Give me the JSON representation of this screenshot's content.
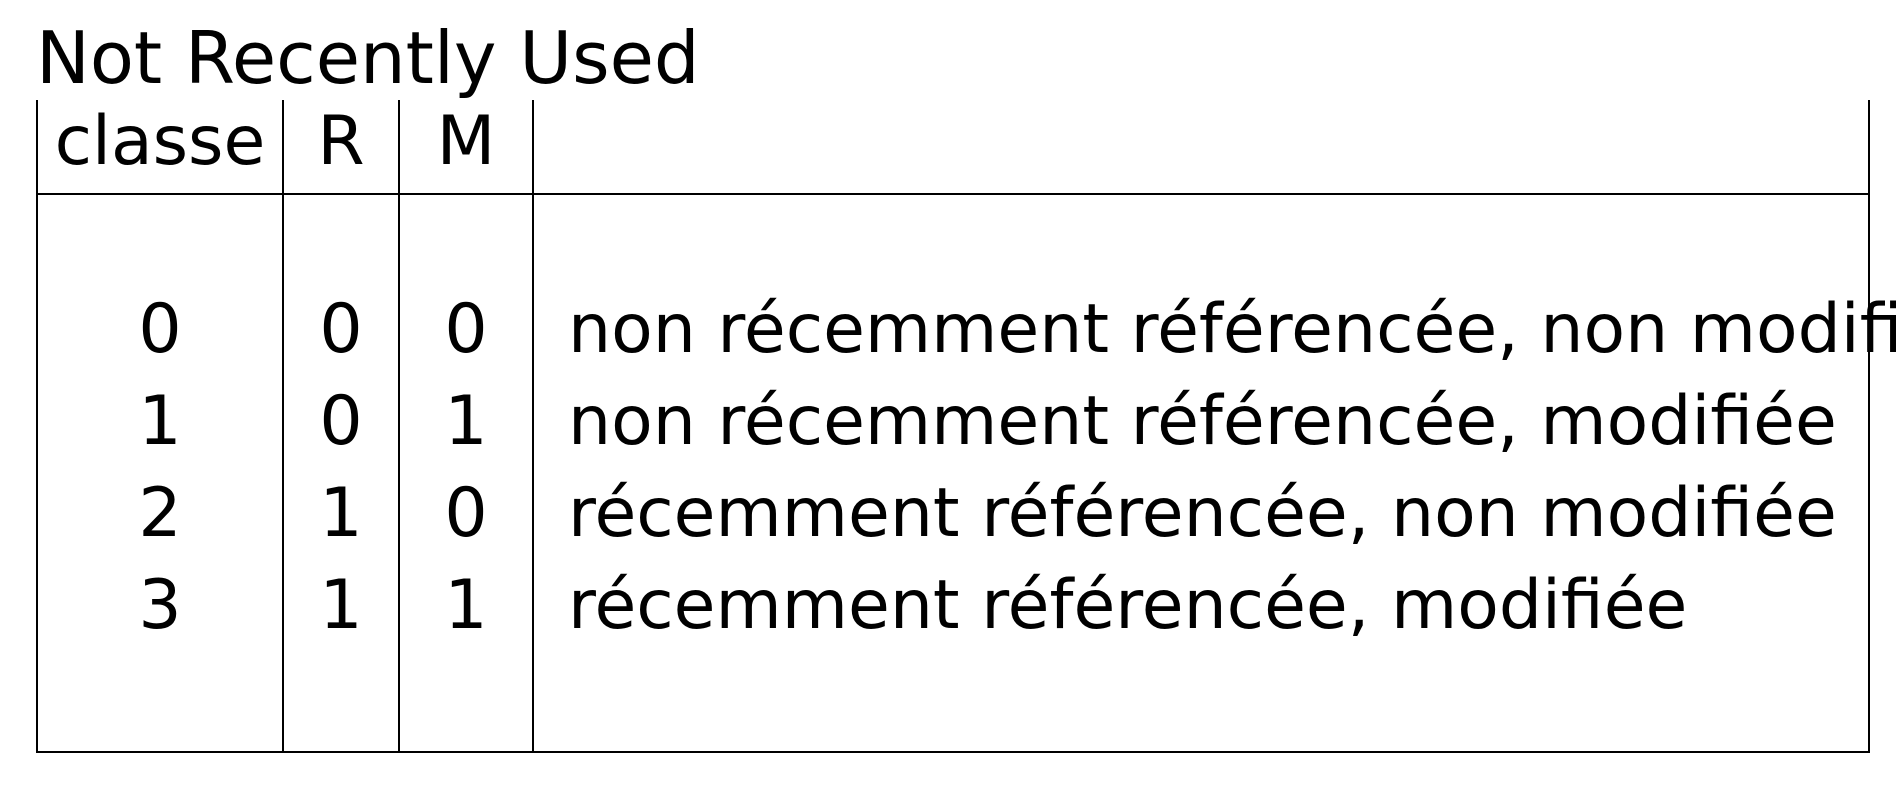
{
  "title": "Not Recently Used",
  "headers": {
    "classe": "classe",
    "r": "R",
    "m": "M",
    "desc": ""
  },
  "rows": [
    {
      "classe": "0",
      "r": "0",
      "m": "0",
      "desc": "non récemment référencée, non modifiée"
    },
    {
      "classe": "1",
      "r": "0",
      "m": "1",
      "desc": "non récemment référencée, modifiée"
    },
    {
      "classe": "2",
      "r": "1",
      "m": "0",
      "desc": "récemment référencée, non modifiée"
    },
    {
      "classe": "3",
      "r": "1",
      "m": "1",
      "desc": "récemment référencée, modifiée"
    }
  ]
}
